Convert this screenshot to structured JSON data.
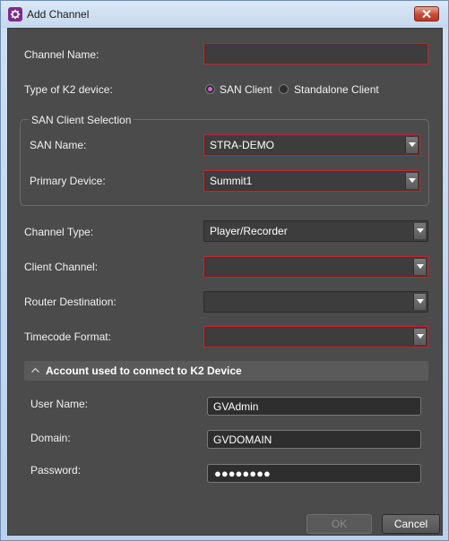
{
  "window": {
    "title": "Add Channel"
  },
  "form": {
    "channel_name": {
      "label": "Channel Name:",
      "value": ""
    },
    "k2_device_type": {
      "label": "Type of K2 device:",
      "options": [
        "SAN Client",
        "Standalone Client"
      ],
      "selected": "SAN Client"
    },
    "san_client_selection": {
      "title": "SAN Client Selection",
      "san_name": {
        "label": "SAN Name:",
        "value": "STRA-DEMO"
      },
      "primary_device": {
        "label": "Primary Device:",
        "value": "Summit1"
      }
    },
    "channel_type": {
      "label": "Channel Type:",
      "value": "Player/Recorder"
    },
    "client_channel": {
      "label": "Client Channel:",
      "value": ""
    },
    "router_destination": {
      "label": "Router Destination:",
      "value": ""
    },
    "timecode_format": {
      "label": "Timecode Format:",
      "value": ""
    }
  },
  "account": {
    "header": "Account used to connect to K2 Device",
    "user_name": {
      "label": "User Name:",
      "value": "GVAdmin"
    },
    "domain": {
      "label": "Domain:",
      "value": "GVDOMAIN"
    },
    "password": {
      "label": "Password:",
      "masked_value": "●●●●●●●●"
    }
  },
  "buttons": {
    "ok": "OK",
    "cancel": "Cancel"
  },
  "colors": {
    "required_border": "#c4262b",
    "radio_selected": "#d565d6",
    "panel_bg": "#4b4b4b"
  },
  "icons": [
    "app-icon",
    "close-icon",
    "chevron-down-icon",
    "chevron-up-icon"
  ]
}
